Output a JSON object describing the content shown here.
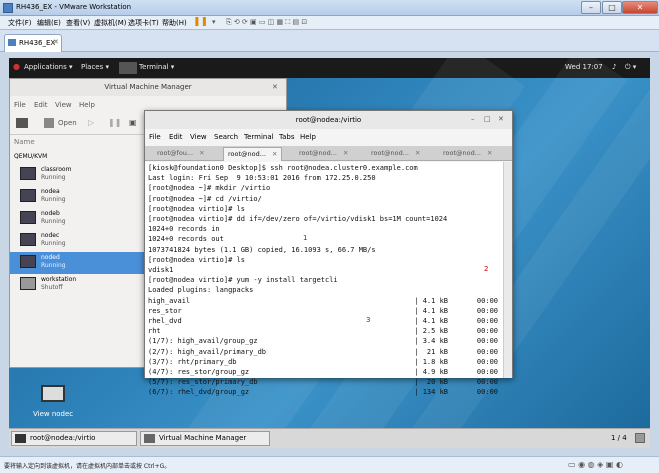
{
  "vmware": {
    "title": "RH436_EX - VMware Workstation",
    "menu": [
      "文件(F)",
      "编辑(E)",
      "查看(V)",
      "虚拟机(M)",
      "选项卡(T)",
      "帮助(H)"
    ],
    "tab": "RH436_EX",
    "status": "要将输入定向到该虚拟机，请在虚拟机内部单击或按 Ctrl+G。"
  },
  "gnome": {
    "applications": "Applications ▾",
    "places": "Places ▾",
    "terminal": "Terminal ▾",
    "clock": "Wed 17:07"
  },
  "vmm": {
    "title": "Virtual Machine Manager",
    "menu": [
      "File",
      "Edit",
      "View",
      "Help"
    ],
    "open": "Open",
    "name_header": "Name",
    "group": "QEMU/KVM",
    "vms": [
      {
        "name": "classroom",
        "state": "Running"
      },
      {
        "name": "nodea",
        "state": "Running"
      },
      {
        "name": "nodeb",
        "state": "Running"
      },
      {
        "name": "nodec",
        "state": "Running"
      },
      {
        "name": "noded",
        "state": "Running"
      },
      {
        "name": "workstation",
        "state": "Shutoff"
      }
    ]
  },
  "desktop": {
    "icon_label": "View nodec"
  },
  "terminal": {
    "title": "root@nodea:/virtio",
    "menu": [
      "File",
      "Edit",
      "View",
      "Search",
      "Terminal",
      "Tabs",
      "Help"
    ],
    "tabs": [
      "root@fou...",
      "root@nod...",
      "root@nod...",
      "root@nod...",
      "root@nod..."
    ],
    "lines": [
      "[kiosk@foundation0 Desktop]$ ssh root@nodea.cluster0.example.com",
      "Last login: Fri Sep  9 10:53:01 2016 from 172.25.0.250",
      "[root@nodea ~]# mkdir /virtio",
      "[root@nodea ~]# cd /virtio/",
      "[root@nodea virtio]# ls",
      "[root@nodea virtio]# dd if=/dev/zero of=/virtio/vdisk1 bs=1M count=1024",
      "1024+0 records in",
      "1024+0 records out",
      "1073741824 bytes (1.1 GB) copied, 16.1093 s, 66.7 MB/s",
      "[root@nodea virtio]# ls",
      "vdisk1",
      "[root@nodea virtio]# yum -y install targetcli",
      "Loaded plugins: langpacks"
    ],
    "yum_rows": [
      {
        "name": "high_avail",
        "size": "| 4.1 kB",
        "time": "00:00"
      },
      {
        "name": "res_stor",
        "size": "| 4.1 kB",
        "time": "00:00"
      },
      {
        "name": "rhel_dvd",
        "size": "| 4.1 kB",
        "time": "00:00"
      },
      {
        "name": "rht",
        "size": "| 2.5 kB",
        "time": "00:00"
      },
      {
        "name": "(1/7): high_avail/group_gz",
        "size": "| 3.4 kB",
        "time": "00:00"
      },
      {
        "name": "(2/7): high_avail/primary_db",
        "size": "|  21 kB",
        "time": "00:00"
      },
      {
        "name": "(3/7): rht/primary_db",
        "size": "| 1.8 kB",
        "time": "00:00"
      },
      {
        "name": "(4/7): res_stor/group_gz",
        "size": "| 4.9 kB",
        "time": "00:00"
      },
      {
        "name": "(5/7): res_stor/primary_db",
        "size": "|  20 kB",
        "time": "00:00"
      },
      {
        "name": "(6/7): rhel_dvd/group_gz",
        "size": "| 134 kB",
        "time": "00:00"
      }
    ],
    "annotations": [
      "1",
      "2",
      "3"
    ]
  },
  "taskbar": {
    "items": [
      "root@nodea:/virtio",
      "Virtual Machine Manager"
    ],
    "pager": "1 / 4"
  }
}
